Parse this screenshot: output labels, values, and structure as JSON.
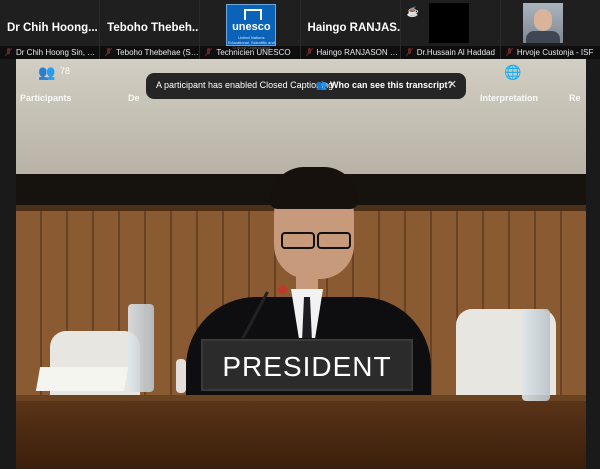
{
  "participants": [
    {
      "display_name": "Dr Chih Hoong...",
      "caption": "Dr Chih Hoong Sin, UK..."
    },
    {
      "display_name": "Teboho  Thebeh...",
      "caption": "Teboho Thebehae (Sou..."
    },
    {
      "display_name": "",
      "caption": "Technicien UNESCO"
    },
    {
      "display_name": "Haingo  RANJAS...",
      "caption": "Haingo RANJASON - ..."
    },
    {
      "display_name": "",
      "caption": "Dr.Hussain Al Haddad"
    },
    {
      "display_name": "",
      "caption": "Hrvoje Custonja - ISF"
    }
  ],
  "unesco_logo": {
    "text": "unesco",
    "subtext": "United Nations Educational, Scientific and Cultural Organization"
  },
  "meeting_screen": {
    "count": "78",
    "labels": [
      "Participants",
      "De",
      "Interpretation",
      "Re"
    ]
  },
  "notification": {
    "message": "A participant has enabled Closed Captioning",
    "link": "Who can see this transcript?"
  },
  "nameplate": {
    "text": "PRESIDENT"
  }
}
